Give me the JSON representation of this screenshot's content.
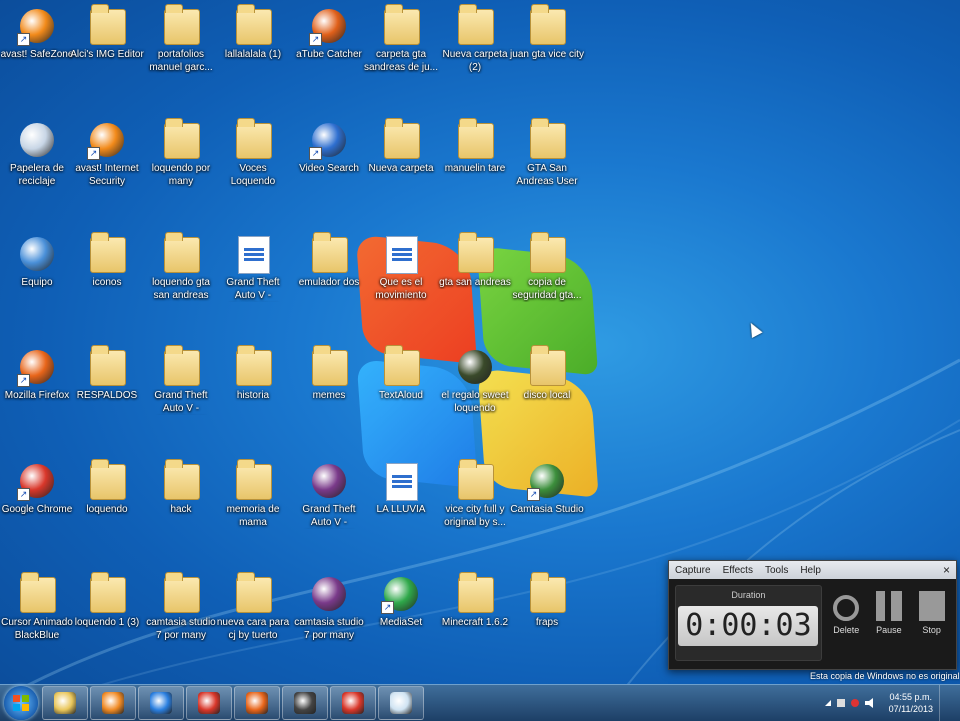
{
  "desktop": {
    "icons": [
      {
        "label": "avast! SafeZone",
        "kind": "circle",
        "color": "#f28a1a",
        "shortcut": true
      },
      {
        "label": "Alci's IMG Editor",
        "kind": "folder"
      },
      {
        "label": "portafolios manuel garc...",
        "kind": "folder"
      },
      {
        "label": "lallalalala (1)",
        "kind": "folder"
      },
      {
        "label": "aTube Catcher",
        "kind": "circle",
        "color": "#e0601a",
        "shortcut": true
      },
      {
        "label": "carpeta gta sandreas de ju...",
        "kind": "folder"
      },
      {
        "label": "Nueva carpeta (2)",
        "kind": "folder"
      },
      {
        "label": "juan gta vice city",
        "kind": "folder"
      },
      {
        "label": "Papelera de reciclaje",
        "kind": "circle",
        "color": "#c8d6e6"
      },
      {
        "label": "avast! Internet Security",
        "kind": "circle",
        "color": "#f28a1a",
        "shortcut": true
      },
      {
        "label": "loquendo por many",
        "kind": "folder"
      },
      {
        "label": "Voces Loquendo",
        "kind": "folder"
      },
      {
        "label": "Video Search",
        "kind": "circle",
        "color": "#2e6fd0",
        "shortcut": true
      },
      {
        "label": "Nueva carpeta",
        "kind": "folder"
      },
      {
        "label": "manuelin tare",
        "kind": "folder"
      },
      {
        "label": "GTA San Andreas User Files",
        "kind": "folder"
      },
      {
        "label": "Equipo",
        "kind": "circle",
        "color": "#4a90d9"
      },
      {
        "label": "iconos",
        "kind": "folder"
      },
      {
        "label": "loquendo gta san andreas",
        "kind": "folder"
      },
      {
        "label": "Grand Theft Auto V - SKIDROW",
        "kind": "doc"
      },
      {
        "label": "emulador dos",
        "kind": "folder"
      },
      {
        "label": "Que es el movimiento",
        "kind": "doc"
      },
      {
        "label": "gta san andreas",
        "kind": "folder"
      },
      {
        "label": "copia de seguridad gta...",
        "kind": "folder"
      },
      {
        "label": "Mozilla Firefox",
        "kind": "circle",
        "color": "#e8651a",
        "shortcut": true
      },
      {
        "label": "RESPALDOS",
        "kind": "folder"
      },
      {
        "label": "Grand Theft Auto V - SKIDROW",
        "kind": "folder"
      },
      {
        "label": "historia",
        "kind": "folder"
      },
      {
        "label": "memes",
        "kind": "folder"
      },
      {
        "label": "TextAloud",
        "kind": "folder"
      },
      {
        "label": "el regalo sweet loquendo",
        "kind": "circle",
        "color": "#3a4a2a"
      },
      {
        "label": "disco local",
        "kind": "folder"
      },
      {
        "label": "Google Chrome",
        "kind": "circle",
        "color": "#d9372a",
        "shortcut": true
      },
      {
        "label": "loquendo",
        "kind": "folder"
      },
      {
        "label": "hack",
        "kind": "folder"
      },
      {
        "label": "memoria de mama",
        "kind": "folder"
      },
      {
        "label": "Grand Theft Auto V - SKIDROW",
        "kind": "circle",
        "color": "#7a3a8a"
      },
      {
        "label": "LA LLUVIA",
        "kind": "doc"
      },
      {
        "label": "vice city full y original by s...",
        "kind": "folder"
      },
      {
        "label": "Camtasia Studio",
        "kind": "circle",
        "color": "#3c8f3c",
        "shortcut": true
      },
      {
        "label": "Cursor Animado BlackBlue",
        "kind": "folder"
      },
      {
        "label": "loquendo 1 (3)",
        "kind": "folder"
      },
      {
        "label": "camtasia studio 7 por many",
        "kind": "folder"
      },
      {
        "label": "nueva cara para cj by tuerto",
        "kind": "folder"
      },
      {
        "label": "camtasia studio 7 por many",
        "kind": "circle",
        "color": "#7a3a8a"
      },
      {
        "label": "MediaSet",
        "kind": "circle",
        "color": "#2fa84a",
        "shortcut": true
      },
      {
        "label": "Minecraft 1.6.2",
        "kind": "folder"
      },
      {
        "label": "fraps",
        "kind": "folder"
      }
    ]
  },
  "recorder": {
    "menu": [
      "Capture",
      "Effects",
      "Tools",
      "Help"
    ],
    "close": "×",
    "duration_label": "Duration",
    "time": "0:00:03",
    "buttons": {
      "delete": "Delete",
      "pause": "Pause",
      "stop": "Stop"
    }
  },
  "watermark": "Esta copia de Windows no es original",
  "taskbar": {
    "apps": [
      {
        "name": "explorer",
        "color": "#e9c65a"
      },
      {
        "name": "media-player",
        "color": "#f08a24"
      },
      {
        "name": "internet-explorer",
        "color": "#2a7fe0"
      },
      {
        "name": "chrome",
        "color": "#d9372a"
      },
      {
        "name": "firefox",
        "color": "#e8651a"
      },
      {
        "name": "recorder",
        "color": "#444444"
      },
      {
        "name": "chrome-2",
        "color": "#d9372a"
      },
      {
        "name": "camtasia",
        "color": "#cfe3f2"
      }
    ],
    "time": "04:55 p.m.",
    "date": "07/11/2013"
  }
}
